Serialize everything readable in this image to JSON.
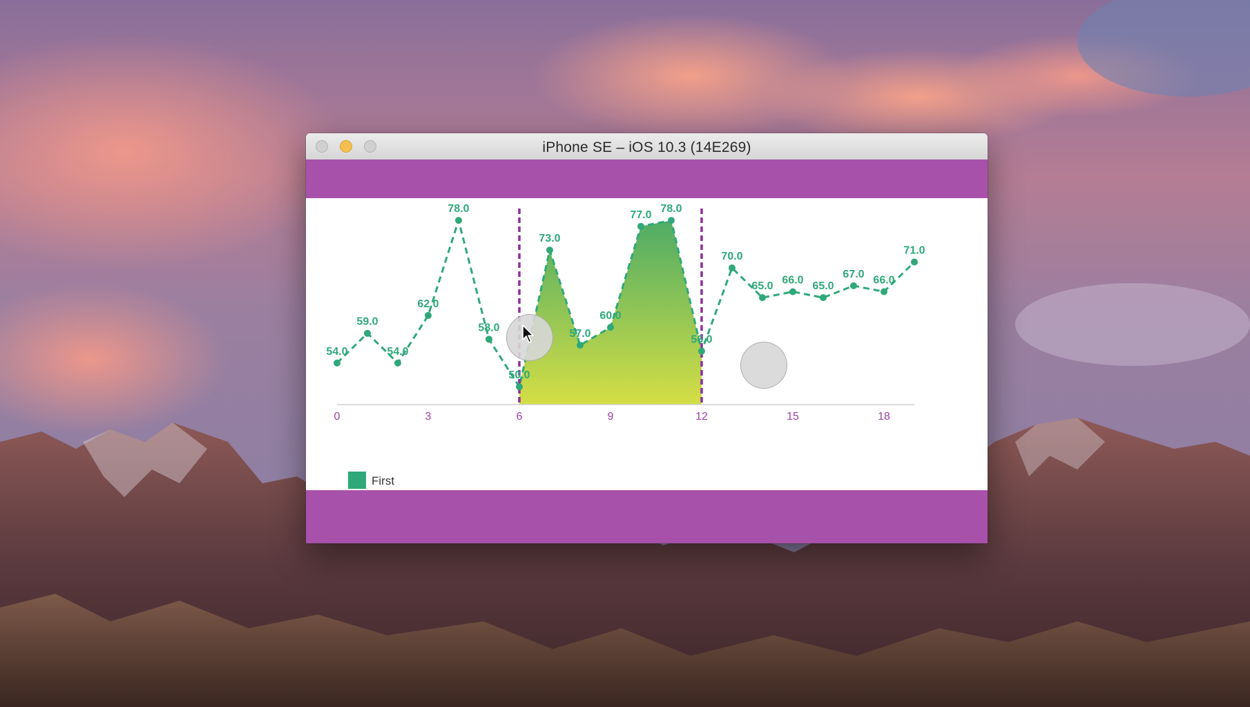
{
  "window": {
    "title": "iPhone SE – iOS 10.3 (14E269)"
  },
  "colors": {
    "nav_bar": "#a751aa",
    "series_line": "#2fa87a",
    "tick_label": "#9c3fa6",
    "selection_line": "#8e2f9a",
    "fill_top": "#4fac66",
    "fill_bottom": "#d4de45"
  },
  "chart_data": {
    "type": "line",
    "x": [
      0,
      1,
      2,
      3,
      4,
      5,
      6,
      7,
      8,
      9,
      10,
      11,
      12,
      13,
      14,
      15,
      16,
      17,
      18,
      19
    ],
    "series": [
      {
        "name": "First",
        "values": [
          54.0,
          59.0,
          54.0,
          62.0,
          78.0,
          58.0,
          50.0,
          73.0,
          57.0,
          60.0,
          77.0,
          78.0,
          56.0,
          70.0,
          65.0,
          66.0,
          65.0,
          67.0,
          66.0,
          71.0
        ],
        "value_labels": [
          "54.0",
          "59.0",
          "54.0",
          "62.0",
          "78.0",
          "58.0",
          "50.0",
          "73.0",
          "57.0",
          "60.0",
          "77.0",
          "78.0",
          "56.0",
          "70.0",
          "65.0",
          "66.0",
          "65.0",
          "67.0",
          "66.0",
          "71.0"
        ]
      }
    ],
    "xticks": [
      0,
      3,
      6,
      9,
      12,
      15,
      18
    ],
    "xtick_labels": [
      "0",
      "3",
      "6",
      "9",
      "12",
      "15",
      "18"
    ],
    "xlim": [
      0,
      19
    ],
    "ylim": [
      47,
      80
    ],
    "highlight_range": [
      6,
      12
    ],
    "line_style": "dashed",
    "grid": false,
    "legend": {
      "position": "bottom-left",
      "items": [
        "First"
      ]
    }
  }
}
